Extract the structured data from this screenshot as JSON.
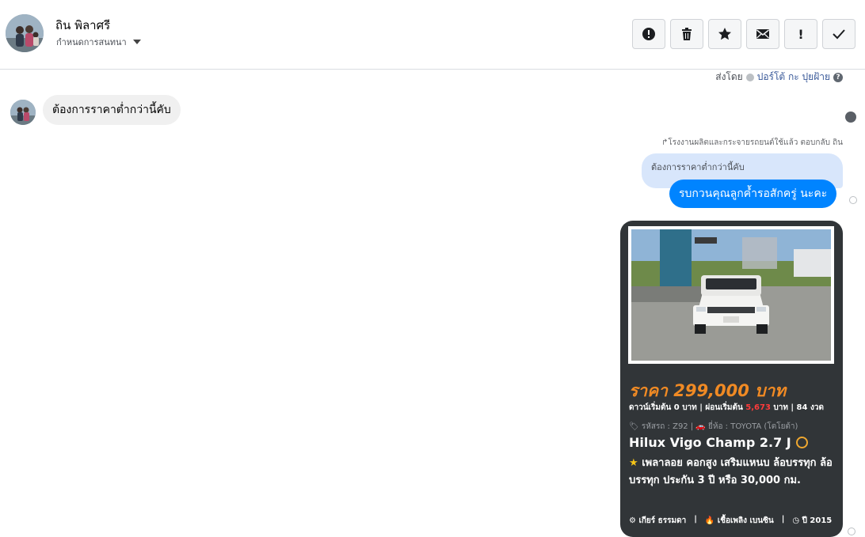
{
  "header": {
    "name": "ถิน พิลาศรี",
    "subtitle": "กำหนดการสนทนา",
    "actions": [
      {
        "name": "report-button",
        "icon": "alert-circle-icon"
      },
      {
        "name": "delete-button",
        "icon": "trash-icon"
      },
      {
        "name": "star-button",
        "icon": "star-icon"
      },
      {
        "name": "mark-unread-button",
        "icon": "envelope-icon"
      },
      {
        "name": "important-button",
        "icon": "exclamation-icon"
      },
      {
        "name": "done-button",
        "icon": "check-icon"
      }
    ]
  },
  "sent_by": {
    "label": "ส่งโดย",
    "who": "ปอร์โต้ กะ ปุยฝ้าย"
  },
  "incoming_message": "ต้องการราคาต่ำกว่านี้คับ",
  "reply": {
    "meta": "↱โรงงานผลิตและกระจายรถยนต์ใช้แล้ว ตอบกลับ ถิน",
    "quoted": "ต้องการราคาต่ำกว่านี้คับ",
    "text": "รบกวนคุณลูกค้ำรอสักครู่ นะคะ"
  },
  "card": {
    "price": "ราคา 299,000 บาท",
    "terms_prefix": "ดาวน์เริ่มต้น 0 บาท | ผ่อนเริ่มต้น",
    "terms_amount": "5,673",
    "terms_suffix": "บาท | 84 งวด",
    "codes": "🏷 รหัสรถ : Z92 | 🚗 ยี่ห้อ : TOYOTA (โตโยต้า)",
    "model": "Hilux Vigo Champ 2.7 J",
    "desc_star": "★",
    "desc": "เพลาลอย คอกสูง เสริมแหนบ ล้อบรรทุก ล้อบรรทุก ประกัน 3 ปี หรือ 30,000 กม.",
    "spec_gear": "⚙ เกียร์ ธรรมดา",
    "spec_fuel": "🔥 เชื้อเพลิง เบนซิน",
    "spec_year": "◷ ปี 2015",
    "sep": "|"
  },
  "colors": {
    "accent": "#0084ff",
    "price": "#f08a24",
    "card_bg": "#313538"
  }
}
